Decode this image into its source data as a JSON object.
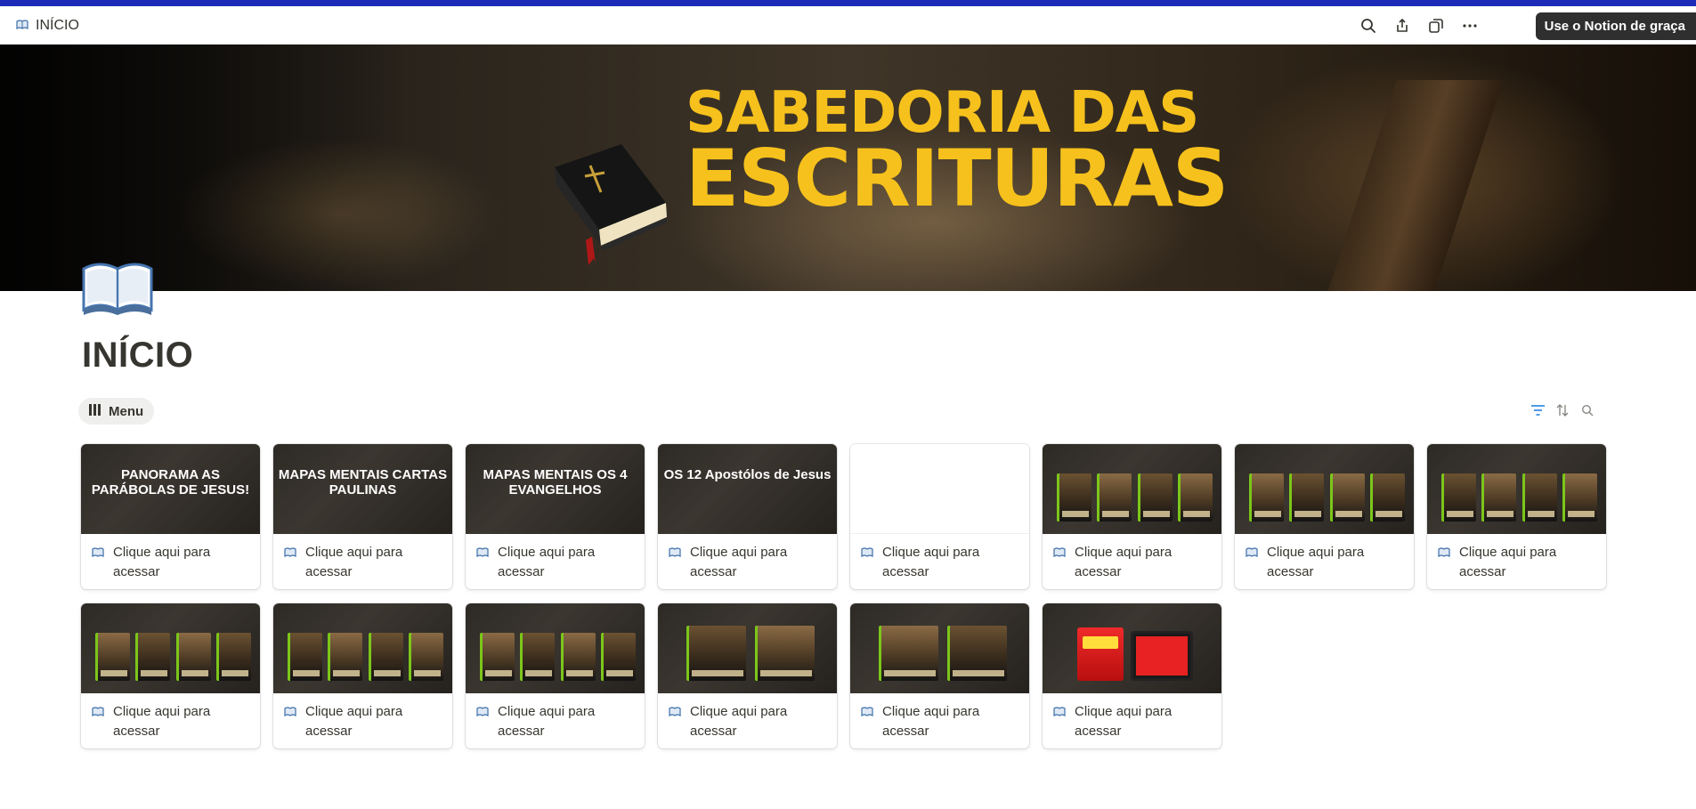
{
  "topbar": {
    "breadcrumb_title": "INÍCIO",
    "cta_label": "Use o Notion de graça",
    "icons": [
      "search-icon",
      "share-icon",
      "duplicate-icon",
      "more-icon"
    ]
  },
  "cover": {
    "line1": "SABEDORIA DAS",
    "line2": "ESCRITURAS",
    "accent": "#f6c11c"
  },
  "page": {
    "icon": "open-book-icon",
    "title": "INÍCIO"
  },
  "view": {
    "tab_label": "Menu",
    "tools": [
      "filter-icon",
      "sort-icon",
      "search-icon"
    ]
  },
  "gallery": {
    "cards": [
      {
        "thumb_title": "PANORAMA AS PARÁBOLAS DE JESUS!",
        "caption": "Clique aqui para acessar"
      },
      {
        "thumb_title": "MAPAS MENTAIS CARTAS PAULINAS",
        "caption": "Clique aqui para acessar"
      },
      {
        "thumb_title": "MAPAS MENTAIS OS 4 EVANGELHOS",
        "caption": "Clique aqui para acessar"
      },
      {
        "thumb_title": "OS 12 Apostólos de Jesus",
        "caption": "Clique aqui para acessar"
      },
      {
        "thumb_title": "",
        "caption": "Clique aqui para acessar"
      },
      {
        "thumb_title": "",
        "caption": "Clique aqui para acessar"
      },
      {
        "thumb_title": "",
        "caption": "Clique aqui para acessar"
      },
      {
        "thumb_title": "",
        "caption": "Clique aqui para acessar"
      },
      {
        "thumb_title": "",
        "caption": "Clique aqui para acessar"
      },
      {
        "thumb_title": "",
        "caption": "Clique aqui para acessar"
      },
      {
        "thumb_title": "",
        "caption": "Clique aqui para acessar"
      },
      {
        "thumb_title": "",
        "caption": "Clique aqui para acessar"
      },
      {
        "thumb_title": "",
        "caption": "Clique aqui para acessar"
      },
      {
        "thumb_title": "",
        "caption": "Clique aqui para acessar"
      }
    ]
  }
}
